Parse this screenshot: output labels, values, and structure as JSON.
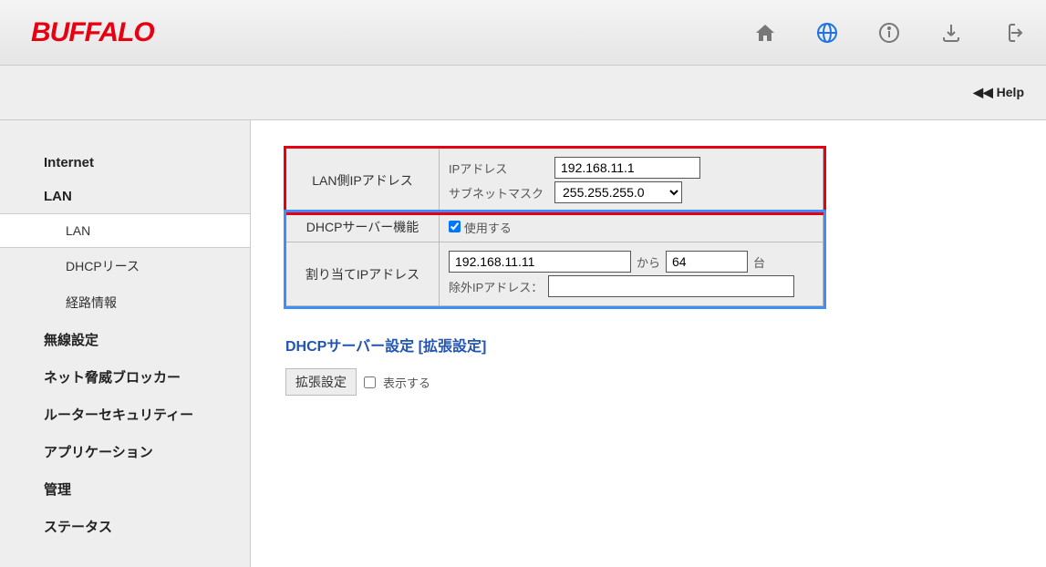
{
  "brand": "BUFFALO",
  "help_label": "◀◀ Help",
  "sidebar": {
    "internet": "Internet",
    "lan": "LAN",
    "lan_sub": "LAN",
    "dhcp_lease": "DHCPリース",
    "route_info": "経路情報",
    "wireless": "無線設定",
    "threat_blocker": "ネット脅威ブロッカー",
    "router_security": "ルーターセキュリティー",
    "application": "アプリケーション",
    "admin": "管理",
    "status": "ステータス"
  },
  "form": {
    "lan_ip_label": "LAN側IPアドレス",
    "ip_label": "IPアドレス",
    "ip_value": "192.168.11.1",
    "subnet_label": "サブネットマスク",
    "subnet_value": "255.255.255.0",
    "dhcp_server_label": "DHCPサーバー機能",
    "use_label": "使用する",
    "assign_ip_label": "割り当てIPアドレス",
    "assign_start": "192.168.11.11",
    "from_label": "から",
    "assign_count": "64",
    "count_unit": "台",
    "exclude_ip_label": "除外IPアドレス：",
    "exclude_ip_value": ""
  },
  "advanced": {
    "heading": "DHCPサーバー設定 [拡張設定]",
    "label": "拡張設定",
    "show_label": "表示する"
  }
}
